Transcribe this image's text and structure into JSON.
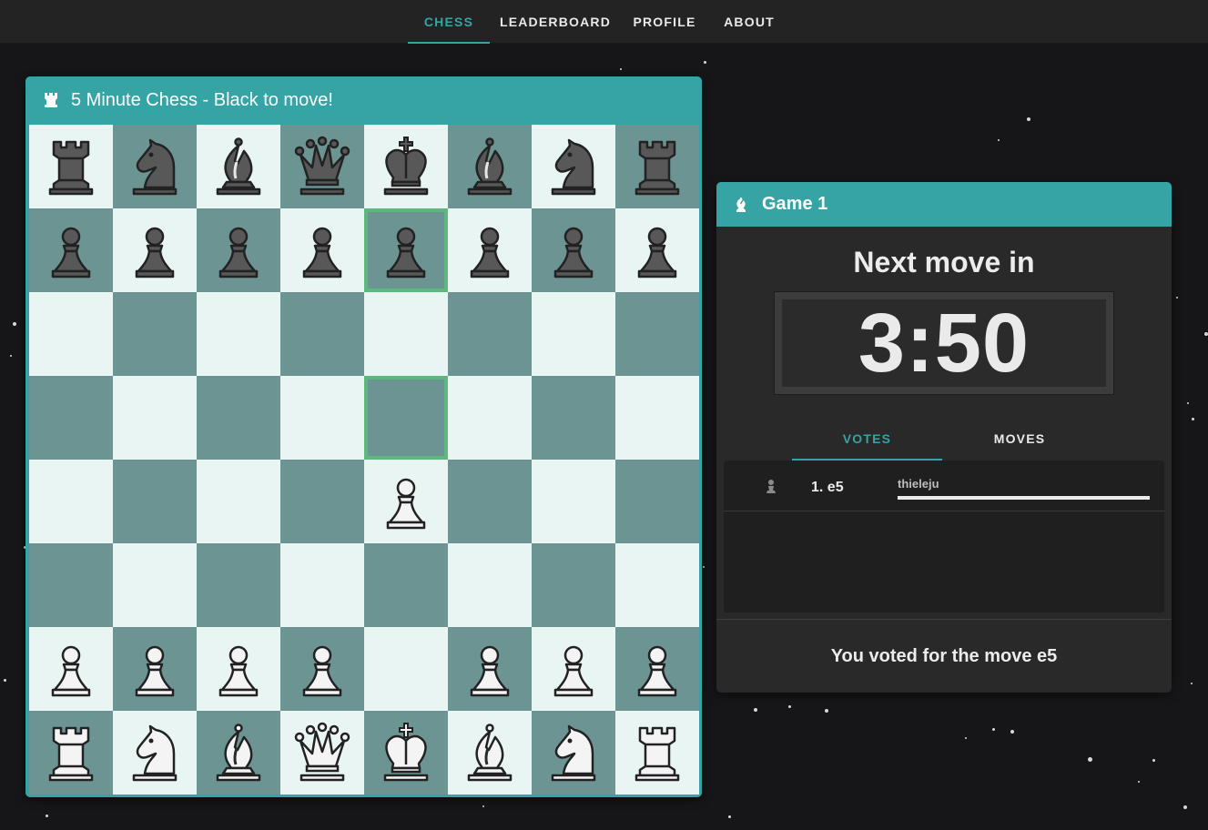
{
  "nav": {
    "tabs": [
      {
        "label": "CHESS",
        "active": true
      },
      {
        "label": "LEADERBOARD",
        "active": false
      },
      {
        "label": "PROFILE",
        "active": false
      },
      {
        "label": "ABOUT",
        "active": false
      }
    ]
  },
  "board_card": {
    "title": "5 Minute Chess - Black to move!",
    "icon": "rook-icon",
    "highlighted_squares": [
      "e7",
      "e5"
    ],
    "rows": [
      [
        "bR",
        "bN",
        "bB",
        "bQ",
        "bK",
        "bB",
        "bN",
        "bR"
      ],
      [
        "bP",
        "bP",
        "bP",
        "bP",
        "bP",
        "bP",
        "bP",
        "bP"
      ],
      [
        "",
        "",
        "",
        "",
        "",
        "",
        "",
        ""
      ],
      [
        "",
        "",
        "",
        "",
        "",
        "",
        "",
        ""
      ],
      [
        "",
        "",
        "",
        "",
        "wP",
        "",
        "",
        ""
      ],
      [
        "",
        "",
        "",
        "",
        "",
        "",
        "",
        ""
      ],
      [
        "wP",
        "wP",
        "wP",
        "wP",
        "",
        "wP",
        "wP",
        "wP"
      ],
      [
        "wR",
        "wN",
        "wB",
        "wQ",
        "wK",
        "wB",
        "wN",
        "wR"
      ]
    ]
  },
  "game_card": {
    "title": "Game 1",
    "icon": "bishop-icon",
    "next_label": "Next move in",
    "timer": "3:50",
    "tabs": [
      {
        "label": "VOTES",
        "active": true
      },
      {
        "label": "MOVES",
        "active": false
      }
    ],
    "votes": [
      {
        "piece_icon": "pawn-icon",
        "move": "1. e5",
        "voter": "thieleju",
        "share": 1.0
      }
    ],
    "voted_text": "You voted for the move e5"
  },
  "colors": {
    "accent": "#36a3a5",
    "light_square": "#e8f5f3",
    "dark_square": "#6b9493",
    "highlight": "#5cb87c",
    "background": "#161618"
  }
}
